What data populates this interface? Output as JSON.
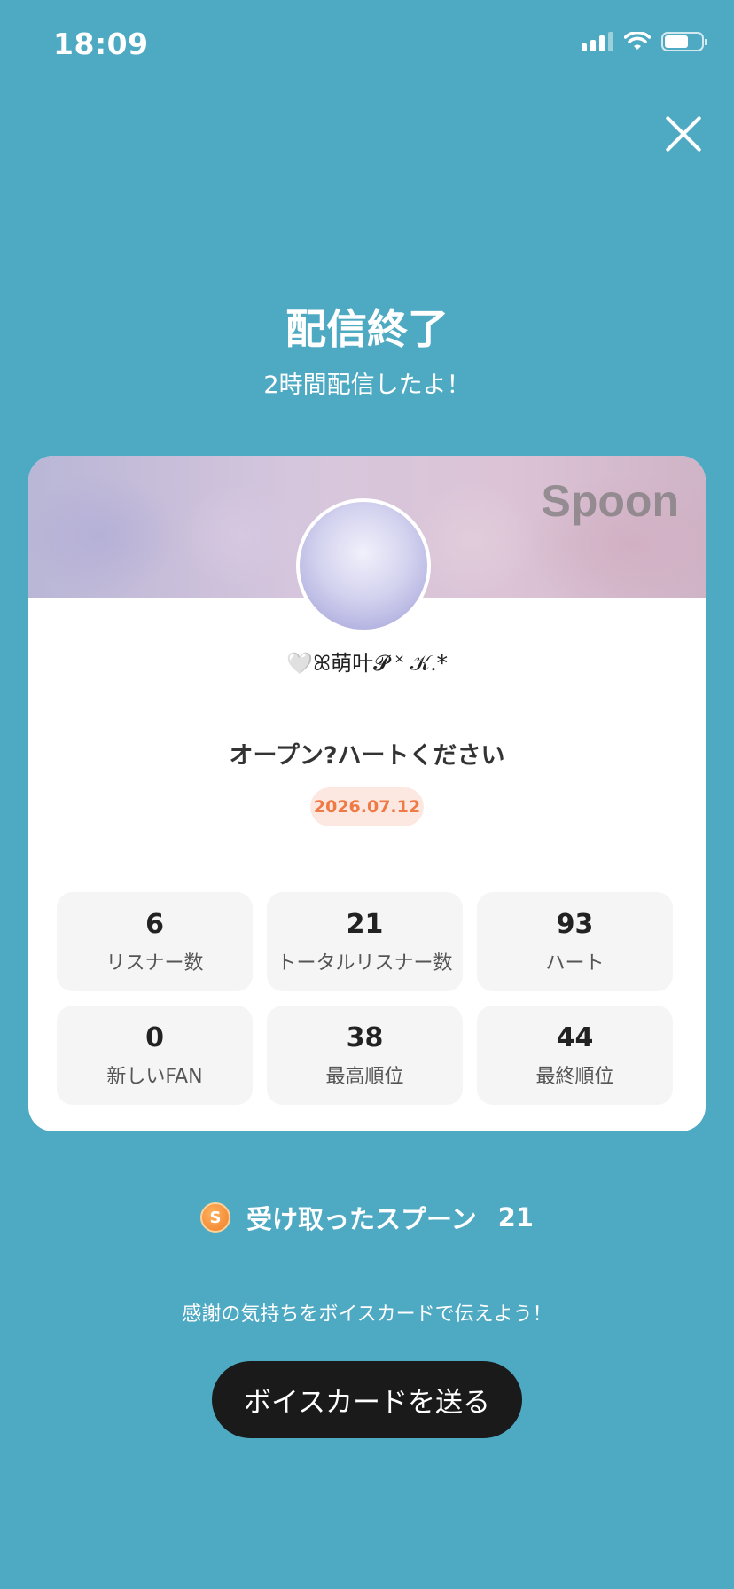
{
  "status_bar": {
    "time": "18:09"
  },
  "header": {
    "title": "配信終了",
    "subtitle": "2時間配信したよ！"
  },
  "card": {
    "logo_text": "Spoon",
    "username": "🤍ꕤ萌叶𝓟 ˟ 𝒦.*",
    "stream_title": "オープン?ハートください",
    "date": "2026.07.12",
    "stats": [
      {
        "value": "6",
        "label": "リスナー数"
      },
      {
        "value": "21",
        "label": "トータルリスナー数"
      },
      {
        "value": "93",
        "label": "ハート"
      },
      {
        "value": "0",
        "label": "新しいFAN"
      },
      {
        "value": "38",
        "label": "最高順位"
      },
      {
        "value": "44",
        "label": "最終順位"
      }
    ]
  },
  "spoons": {
    "coin_symbol": "S",
    "label": "受け取ったスプーン",
    "count": "21"
  },
  "footer": {
    "message": "感謝の気持ちをボイスカードで伝えよう！",
    "button_label": "ボイスカードを送る"
  },
  "colors": {
    "background": "#4ea9c2",
    "date_accent": "#f07a45",
    "button": "#1a1a1a"
  }
}
